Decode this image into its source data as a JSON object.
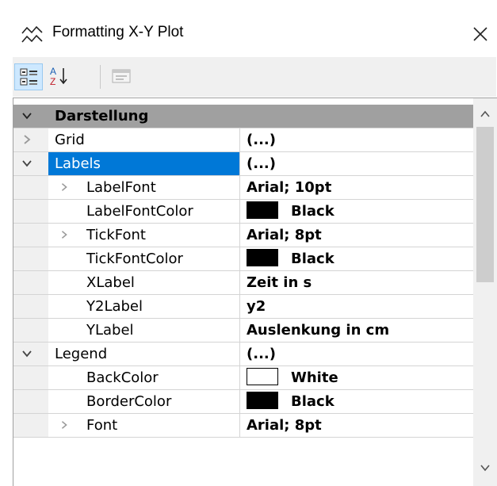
{
  "window": {
    "title": "Formatting X-Y Plot"
  },
  "toolbar": {
    "categorized_tooltip": "Categorized",
    "alphabetical_tooltip": "Alphabetical",
    "pages_tooltip": "Property Pages"
  },
  "rows": [
    {
      "name": "Darstellung",
      "value": "",
      "kind": "category",
      "expander": "expanded"
    },
    {
      "name": "Grid",
      "value": "(...)",
      "kind": "property",
      "expander": "collapsed"
    },
    {
      "name": "Labels",
      "value": "(...)",
      "kind": "property",
      "expander": "expanded",
      "selected": true
    },
    {
      "name": "LabelFont",
      "value": "Arial; 10pt",
      "kind": "sub",
      "expander": "collapsed"
    },
    {
      "name": "LabelFontColor",
      "value": "Black",
      "kind": "sub",
      "swatch": "#000000"
    },
    {
      "name": "TickFont",
      "value": "Arial; 8pt",
      "kind": "sub",
      "expander": "collapsed"
    },
    {
      "name": "TickFontColor",
      "value": "Black",
      "kind": "sub",
      "swatch": "#000000"
    },
    {
      "name": "XLabel",
      "value": "Zeit in s",
      "kind": "sub"
    },
    {
      "name": "Y2Label",
      "value": "y2",
      "kind": "sub"
    },
    {
      "name": "YLabel",
      "value": "Auslenkung in cm",
      "kind": "sub"
    },
    {
      "name": "Legend",
      "value": "(...)",
      "kind": "property",
      "expander": "expanded"
    },
    {
      "name": "BackColor",
      "value": "White",
      "kind": "sub",
      "swatch": "#ffffff"
    },
    {
      "name": "BorderColor",
      "value": "Black",
      "kind": "sub",
      "swatch": "#000000"
    },
    {
      "name": "Font",
      "value": "Arial; 8pt",
      "kind": "sub",
      "expander": "collapsed"
    }
  ],
  "colors": {
    "selection": "#0078d7",
    "category_bar": "#a0a0a0",
    "margin": "#f0f0f0"
  }
}
